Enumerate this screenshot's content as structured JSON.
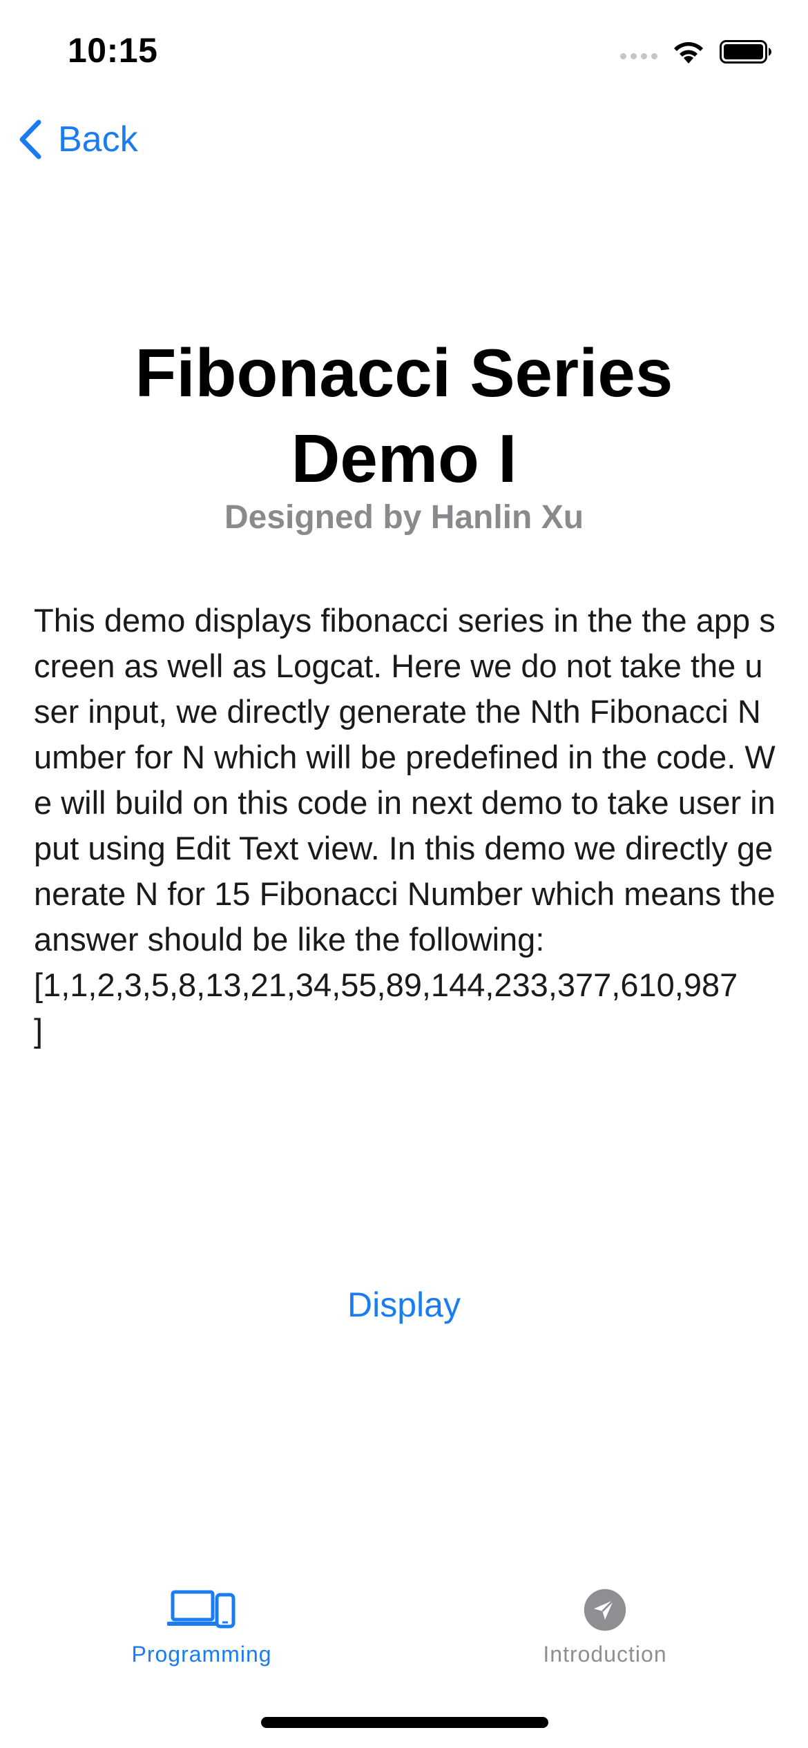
{
  "status_bar": {
    "time": "10:15"
  },
  "nav": {
    "back_label": "Back",
    "back_icon": "chevron-left-icon"
  },
  "content": {
    "title": "Fibonacci Series\nDemo I",
    "subtitle": "Designed by Hanlin Xu",
    "body": "     This demo displays fibonacci series in the the app screen as well as Logcat. Here we do not take the user input, we directly generate the Nth Fibonacci Number for N which will be predefined in the code. We will build on this code in next demo to take user input using Edit Text view. In this demo we directly generate N for 15 Fibonacci Number which means the answer should be like the following:\n[1,1,2,3,5,8,13,21,34,55,89,144,233,377,610,987\n]",
    "display_button": "Display"
  },
  "tab_bar": {
    "items": [
      {
        "label": "Programming",
        "icon": "laptop-phone-icon",
        "selected": true
      },
      {
        "label": "Introduction",
        "icon": "paper-plane-icon",
        "selected": false
      }
    ]
  },
  "colors": {
    "accent": "#1a7cf0",
    "inactive": "#8e8e93",
    "subtitle": "#8a8a8e"
  }
}
